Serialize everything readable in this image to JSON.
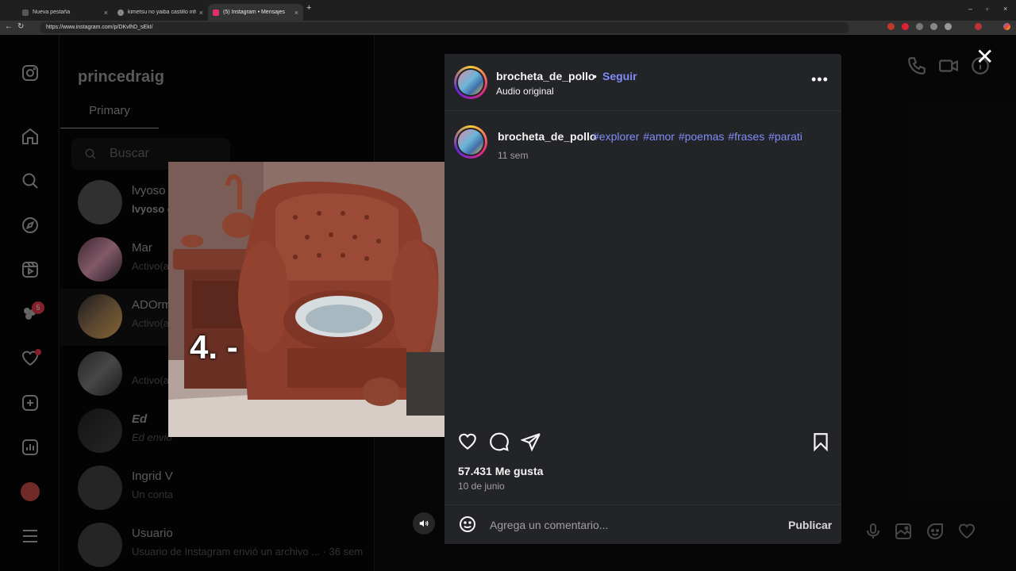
{
  "browser": {
    "tabs": [
      {
        "label": "Nueva pestaña",
        "color": "#555555"
      },
      {
        "label": "kimetsu no yaiba castillo infinito",
        "color": "#888888"
      },
      {
        "label": "(5) Instagram • Mensajes",
        "color": "#e1306c"
      }
    ],
    "url": "https://www.instagram.com/p/DKvlhD_sEkI/"
  },
  "inbox": {
    "username": "princedraig",
    "tab": "Primary",
    "search_placeholder": "Buscar",
    "conversations": [
      {
        "name": "lvyoso",
        "sub": "lvyoso e"
      },
      {
        "name": "Mar",
        "sub": "Activo(a)"
      },
      {
        "name": "ADOrm",
        "sub": "Activo(a)"
      },
      {
        "name": "",
        "sub": "Activo(a)"
      },
      {
        "name": "Ed",
        "sub": "Ed envió"
      },
      {
        "name": "Ingrid V",
        "sub": "Un conta"
      },
      {
        "name": "Usuario",
        "sub": "Usuario de Instagram envió un archivo ... · 36 sem"
      }
    ],
    "notification_badge": "5"
  },
  "post": {
    "username": "brocheta_de_pollo",
    "separator": "•",
    "follow": "Seguir",
    "audio": "Audio original",
    "caption_user": "brocheta_de_pollo",
    "caption_tags": "#explorer #amor #poemas #frases #parati",
    "caption_time": "11 sem",
    "image_caption": "4. -",
    "likes": "57.431 Me gusta",
    "date": "10 de junio",
    "comment_placeholder": "Agrega un comentario...",
    "publish": "Publicar",
    "more": "•••",
    "close": "✕"
  }
}
